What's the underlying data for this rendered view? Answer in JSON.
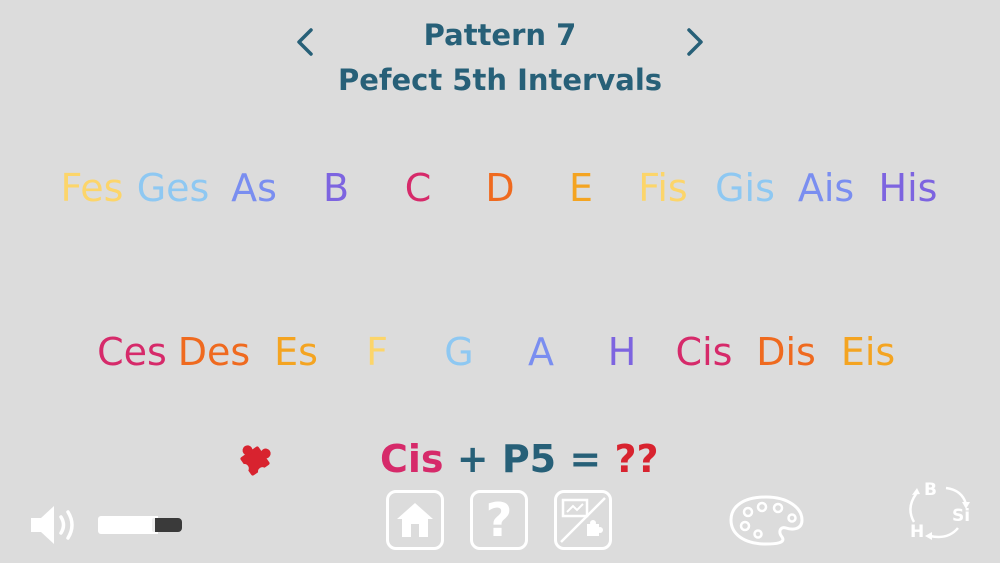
{
  "header": {
    "title": "Pattern 7",
    "subtitle": "Pefect 5th Intervals"
  },
  "row1": [
    {
      "label": "Fes",
      "color": "#fcd56a"
    },
    {
      "label": "Ges",
      "color": "#8ec8f2"
    },
    {
      "label": "As",
      "color": "#7a8ef0"
    },
    {
      "label": "B",
      "color": "#7d64e0"
    },
    {
      "label": "C",
      "color": "#d62a6a"
    },
    {
      "label": "D",
      "color": "#ef6a1f"
    },
    {
      "label": "E",
      "color": "#f4a421"
    },
    {
      "label": "Fis",
      "color": "#fcd56a"
    },
    {
      "label": "Gis",
      "color": "#8ec8f2"
    },
    {
      "label": "Ais",
      "color": "#7a8ef0"
    },
    {
      "label": "His",
      "color": "#7d64e0"
    }
  ],
  "row2": [
    {
      "label": "Ces",
      "color": "#d62a6a"
    },
    {
      "label": "Des",
      "color": "#ef6a1f"
    },
    {
      "label": "Es",
      "color": "#f4a421"
    },
    {
      "label": "F",
      "color": "#fcd56a"
    },
    {
      "label": "G",
      "color": "#8ec8f2"
    },
    {
      "label": "A",
      "color": "#7a8ef0"
    },
    {
      "label": "H",
      "color": "#7d64e0"
    },
    {
      "label": "Cis",
      "color": "#d62a6a"
    },
    {
      "label": "Dis",
      "color": "#ef6a1f"
    },
    {
      "label": "Eis",
      "color": "#f4a421"
    }
  ],
  "question": {
    "note": "Cis",
    "operator": "+ P5 =",
    "answer": "??"
  },
  "toolbar": {
    "help_label": "?"
  },
  "notation": {
    "b": "B",
    "si": "Si",
    "h": "H"
  },
  "icons": {
    "prev": "chevron-left-icon",
    "next": "chevron-right-icon",
    "hint": "puzzle-piece-icon",
    "volume": "speaker-icon",
    "home": "home-icon",
    "help": "question-mark-icon",
    "exercise": "whiteboard-puzzle-icon",
    "palette": "palette-icon",
    "notation": "note-naming-cycle-icon"
  },
  "colors": {
    "background": "#dcdcdc",
    "title": "#276078",
    "answer": "#d8232f",
    "puzzle": "#d8232f"
  }
}
